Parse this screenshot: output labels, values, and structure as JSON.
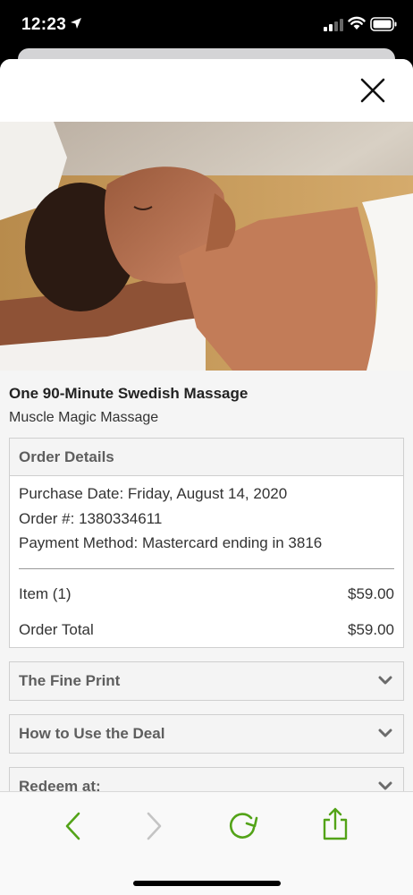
{
  "status_bar": {
    "time": "12:23"
  },
  "deal": {
    "title": "One 90-Minute Swedish Massage",
    "merchant": "Muscle Magic Massage"
  },
  "order_details": {
    "heading": "Order Details",
    "purchase_date": "Purchase Date: Friday, August 14, 2020",
    "order_number": "Order #: 1380334611",
    "payment_method": "Payment Method: Mastercard ending in 3816",
    "item_label": "Item (1)",
    "item_price": "$59.00",
    "total_label": "Order Total",
    "total_price": "$59.00"
  },
  "sections": [
    {
      "label": "The Fine Print"
    },
    {
      "label": "How to Use the Deal"
    },
    {
      "label": "Redeem at:"
    }
  ],
  "colors": {
    "accent_green": "#53a318",
    "disabled_gray": "#c4c4c4"
  },
  "icons": {
    "close": "close-icon",
    "chevron": "chevron-down-icon",
    "back": "back-arrow-icon",
    "forward": "forward-arrow-icon",
    "refresh": "refresh-icon",
    "share": "share-icon"
  }
}
